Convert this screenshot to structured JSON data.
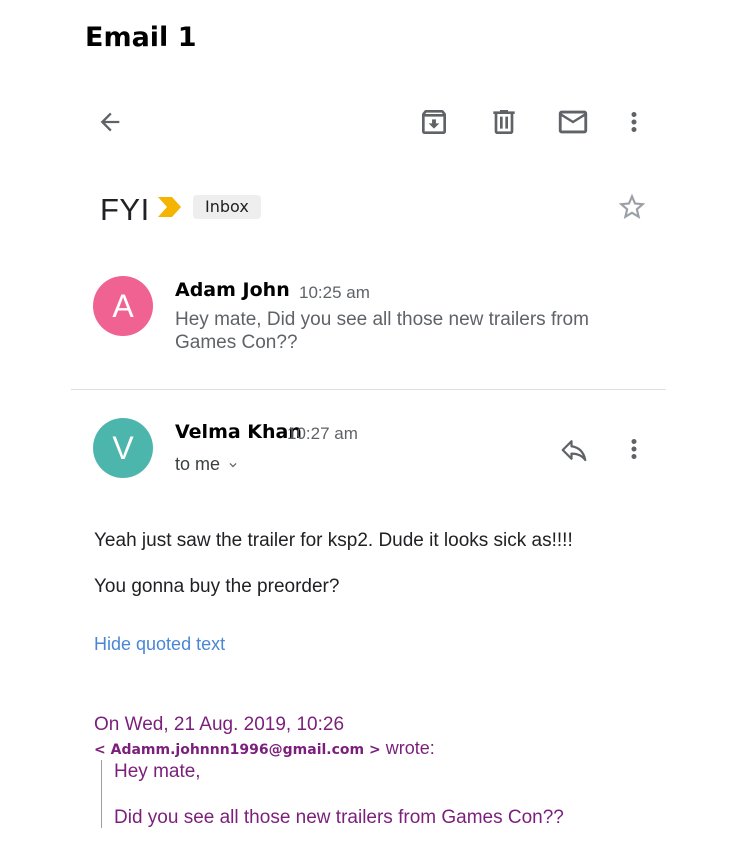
{
  "page": {
    "heading": "Email 1"
  },
  "toolbar": {
    "icons": [
      "back-arrow-icon",
      "archive-icon",
      "delete-icon",
      "mail-icon",
      "more-vert-icon"
    ]
  },
  "thread": {
    "subject": "FYI",
    "label": "Inbox",
    "colors": {
      "importance": "#f4b400",
      "quote": "#7b1f7b",
      "link": "#4a86d4"
    }
  },
  "messages": [
    {
      "avatar_initial": "A",
      "avatar_color": "#f06292",
      "sender": "Adam John",
      "time": "10:25 am",
      "snippet": "Hey mate, Did you see all those new trailers from Games Con??"
    },
    {
      "avatar_initial": "V",
      "avatar_color": "#4db6ac",
      "sender": "Velma Khan",
      "time": "10:27 am",
      "recipient": "to me",
      "body": [
        "Yeah just saw the trailer for ksp2. Dude it looks sick as!!!!",
        "You gonna buy the preorder?"
      ],
      "hide_quoted": "Hide quoted text",
      "quote_header": "On Wed, 21 Aug. 2019, 10:26",
      "quote_email": "< Adamm.johnnn1996@gmail.com >",
      "quote_wrote": " wrote:",
      "quote_lines": [
        "Hey mate,",
        "Did you see all those new trailers from Games Con??"
      ]
    }
  ]
}
